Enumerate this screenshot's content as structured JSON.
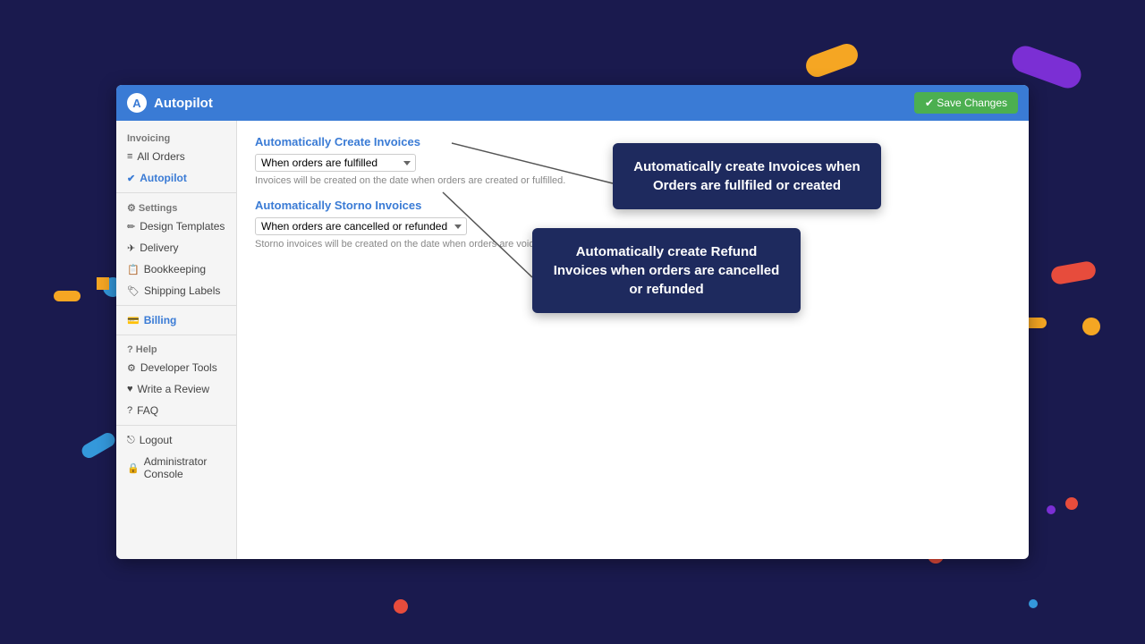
{
  "header": {
    "logo_text": "A",
    "title": "Autopilot",
    "save_button_label": "✔ Save Changes"
  },
  "sidebar": {
    "sections": [
      {
        "label": "Invoicing",
        "items": [
          {
            "id": "all-orders",
            "icon": "≡",
            "label": "All Orders"
          },
          {
            "id": "autopilot",
            "icon": "✔",
            "label": "Autopilot",
            "active": true
          }
        ]
      },
      {
        "label": "Settings",
        "items": [
          {
            "id": "design-templates",
            "icon": "✏",
            "label": "Design Templates"
          },
          {
            "id": "delivery",
            "icon": "✈",
            "label": "Delivery"
          },
          {
            "id": "bookkeeping",
            "icon": "📋",
            "label": "Bookkeeping"
          },
          {
            "id": "shipping-labels",
            "icon": "🏷",
            "label": "Shipping Labels"
          }
        ]
      },
      {
        "label": "Billing",
        "items": []
      },
      {
        "label": "Help",
        "items": [
          {
            "id": "developer-tools",
            "icon": "⚙",
            "label": "Developer Tools"
          },
          {
            "id": "write-a-review",
            "icon": "♥",
            "label": "Write a Review"
          },
          {
            "id": "faq",
            "icon": "?",
            "label": "FAQ"
          }
        ]
      },
      {
        "label": "",
        "items": [
          {
            "id": "logout",
            "icon": "⎋",
            "label": "Logout"
          },
          {
            "id": "admin-console",
            "icon": "🔒",
            "label": "Administrator Console"
          }
        ]
      }
    ]
  },
  "main": {
    "section1": {
      "title": "Automatically Create Invoices",
      "select_label": "When orders are fulfilled",
      "select_value": "When orders are fulfilled",
      "hint": "Invoices will be created on the date when orders are created or fulfilled."
    },
    "section2": {
      "title": "Automatically Storno Invoices",
      "select_label": "When orders are cancelled or refunded",
      "select_value": "When orders are cancelled or refunded",
      "hint": "Storno invoices will be created on the date when orders are voided/cancelled or refunds are created."
    }
  },
  "tooltips": {
    "tooltip1": {
      "text": "Automatically create Invoices when Orders are fullfiled or created"
    },
    "tooltip2": {
      "text": "Automatically create Refund Invoices when orders are cancelled or refunded"
    }
  }
}
